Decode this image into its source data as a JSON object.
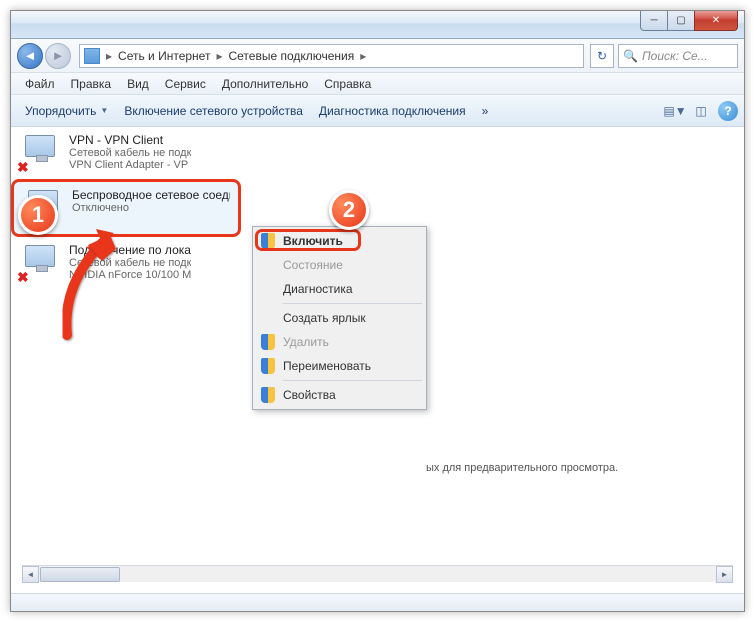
{
  "window": {
    "breadcrumb": [
      "Сеть и Интернет",
      "Сетевые подключения"
    ],
    "search_placeholder": "Поиск: Се..."
  },
  "menu": [
    "Файл",
    "Правка",
    "Вид",
    "Сервис",
    "Дополнительно",
    "Справка"
  ],
  "toolbar": {
    "organize": "Упорядочить",
    "enable": "Включение сетевого устройства",
    "diagnose": "Диагностика подключения",
    "more": "»"
  },
  "connections": [
    {
      "title": "VPN - VPN Client",
      "sub1": "Сетевой кабель не подк",
      "sub2": "VPN Client Adapter - VP",
      "x": true
    },
    {
      "title": "Беспроводное сетевое соединение",
      "sub1": "Отключено",
      "sub2": "",
      "highlight": true,
      "wifi": true
    },
    {
      "title": "Подключение по лока",
      "sub1": "Сетевой кабель не подк",
      "sub2": "NVIDIA nForce 10/100 M",
      "x": true
    }
  ],
  "context_menu": {
    "enable": "Включить",
    "status": "Состояние",
    "diagnostics": "Диагностика",
    "create_shortcut": "Создать ярлык",
    "delete": "Удалить",
    "rename": "Переименовать",
    "properties": "Свойства"
  },
  "preview_text": "ых для предварительного просмотра.",
  "badges": {
    "1": "1",
    "2": "2"
  }
}
